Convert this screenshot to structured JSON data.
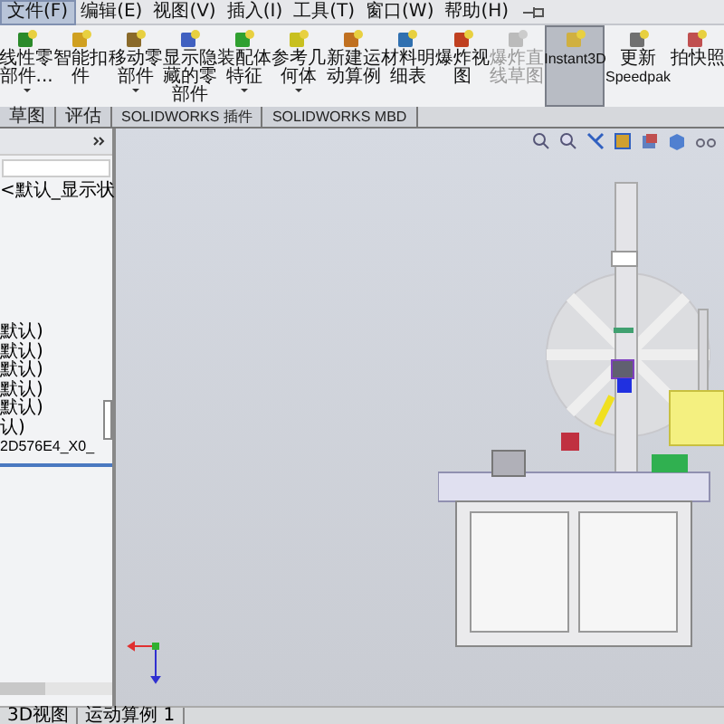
{
  "menu": [
    {
      "label": "文件(F)",
      "selected": true
    },
    {
      "label": "编辑(E)",
      "selected": false
    },
    {
      "label": "视图(V)",
      "selected": false
    },
    {
      "label": "插入(I)",
      "selected": false
    },
    {
      "label": "工具(T)",
      "selected": false
    },
    {
      "label": "窗口(W)",
      "selected": false
    },
    {
      "label": "帮助(H)",
      "selected": false
    }
  ],
  "toolbar": [
    {
      "lines": [
        "线性零",
        "部件..."
      ],
      "has_menu": true,
      "disabled": false,
      "selected": false
    },
    {
      "lines": [
        "智能扣",
        "件"
      ],
      "has_menu": false,
      "disabled": false,
      "selected": false
    },
    {
      "lines": [
        "移动零",
        "部件"
      ],
      "has_menu": true,
      "disabled": false,
      "selected": false
    },
    {
      "lines": [
        "显示隐",
        "藏的零",
        "部件"
      ],
      "has_menu": false,
      "disabled": false,
      "selected": false
    },
    {
      "lines": [
        "装配体",
        "特征"
      ],
      "has_menu": true,
      "disabled": false,
      "selected": false
    },
    {
      "lines": [
        "参考几",
        "何体"
      ],
      "has_menu": true,
      "disabled": false,
      "selected": false
    },
    {
      "lines": [
        "新建运",
        "动算例"
      ],
      "has_menu": false,
      "disabled": false,
      "selected": false
    },
    {
      "lines": [
        "材料明",
        "细表"
      ],
      "has_menu": false,
      "disabled": false,
      "selected": false
    },
    {
      "lines": [
        "爆炸视",
        "图"
      ],
      "has_menu": false,
      "disabled": false,
      "selected": false
    },
    {
      "lines": [
        "爆炸直",
        "线草图"
      ],
      "has_menu": false,
      "disabled": true,
      "selected": false
    },
    {
      "lines": [
        "Instant3D"
      ],
      "has_menu": false,
      "disabled": false,
      "selected": true
    },
    {
      "lines": [
        "更新",
        "Speedpak"
      ],
      "has_menu": false,
      "disabled": false,
      "selected": false
    },
    {
      "lines": [
        "拍快照"
      ],
      "has_menu": false,
      "disabled": false,
      "selected": false
    }
  ],
  "tabs": [
    {
      "label": "草图",
      "selected": false
    },
    {
      "label": "评估",
      "selected": false
    },
    {
      "label": "SOLIDWORKS 插件",
      "selected": false
    },
    {
      "label": "SOLIDWORKS MBD",
      "selected": false
    }
  ],
  "tree": {
    "top_item": "<默认_显示状",
    "items": [
      "默认)",
      "默认)",
      "默认)",
      "默认)",
      "默认)",
      "认)",
      "2D576E4_X0_"
    ]
  },
  "status_bar": [
    "3D视图",
    "运动算例 1"
  ]
}
